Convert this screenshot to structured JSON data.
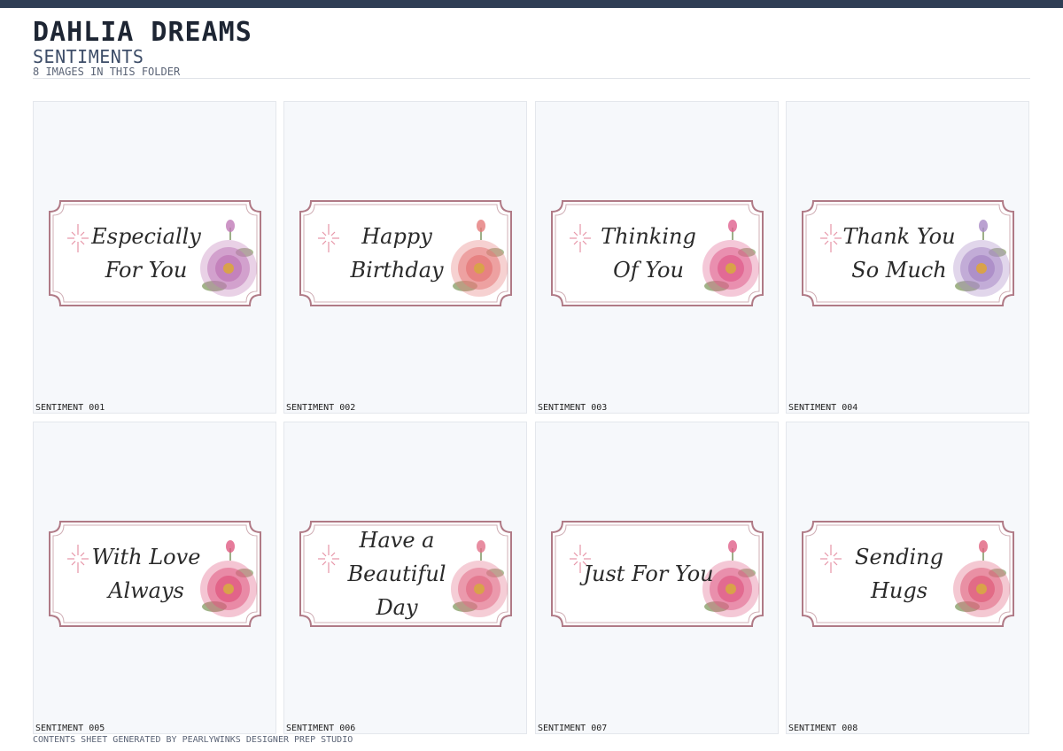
{
  "header": {
    "title": "DAHLIA DREAMS",
    "subtitle": "SENTIMENTS",
    "count": "8 IMAGES IN THIS FOLDER"
  },
  "tiles": [
    {
      "label": "SENTIMENT 001",
      "text": "Especially\nFor You",
      "flower": "#c07ab8"
    },
    {
      "label": "SENTIMENT 002",
      "text": "Happy\nBirthday",
      "flower": "#e57a7a"
    },
    {
      "label": "SENTIMENT 003",
      "text": "Thinking\nOf You",
      "flower": "#e0608e"
    },
    {
      "label": "SENTIMENT 004",
      "text": "Thank You\nSo Much",
      "flower": "#a98ac6"
    },
    {
      "label": "SENTIMENT 005",
      "text": "With Love\nAlways",
      "flower": "#e05a82"
    },
    {
      "label": "SENTIMENT 006",
      "text": "Have a\nBeautiful Day",
      "flower": "#e2708a"
    },
    {
      "label": "SENTIMENT 007",
      "text": "Just For You",
      "flower": "#e0608a"
    },
    {
      "label": "SENTIMENT 008",
      "text": "Sending\nHugs",
      "flower": "#e0627e"
    }
  ],
  "footer": "CONTENTS SHEET GENERATED BY PEARLYWINKS DESIGNER PREP STUDIO",
  "colors": {
    "frame": "#b07a86",
    "accent": "#e07a92"
  }
}
